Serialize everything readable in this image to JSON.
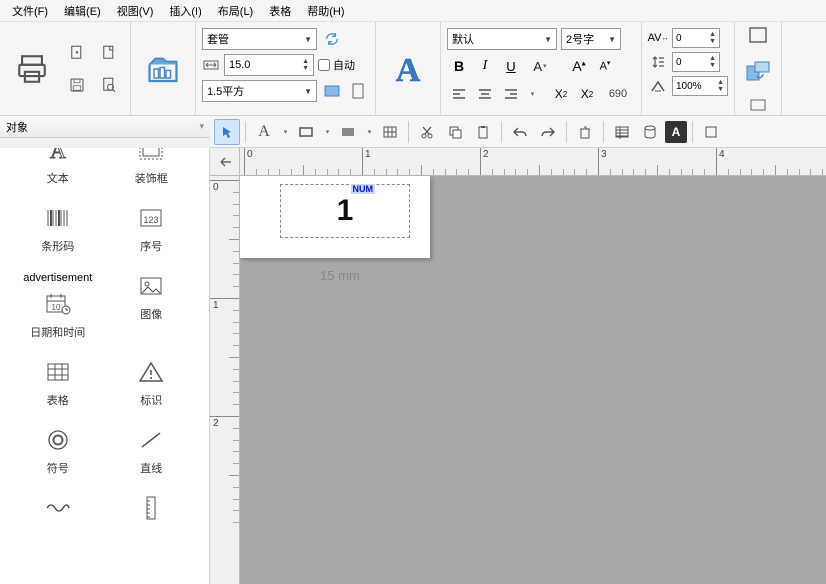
{
  "menu": [
    "文件(F)",
    "编辑(E)",
    "视图(V)",
    "插入(I)",
    "布局(L)",
    "表格",
    "帮助(H)"
  ],
  "toolbar": {
    "tube_combo": "套管",
    "width_value": "15.0",
    "auto_label": "自动",
    "units_combo": "1.5平方",
    "font_combo": "默认",
    "size_combo": "2号字",
    "av_value": "0",
    "line_value": "0",
    "xx_value": "690",
    "zoom_value": "100%"
  },
  "panel": {
    "title": "对象",
    "items": [
      {
        "icon": "text",
        "label": "文本"
      },
      {
        "icon": "frame",
        "label": "装饰框"
      },
      {
        "icon": "barcode",
        "label": "条形码"
      },
      {
        "icon": "serial",
        "label": "序号"
      },
      {
        "icon": "datetime",
        "label": "日期和时间"
      },
      {
        "icon": "image",
        "label": "图像"
      },
      {
        "icon": "table",
        "label": "表格"
      },
      {
        "icon": "warn",
        "label": "标识"
      },
      {
        "icon": "symbol",
        "label": "符号"
      },
      {
        "icon": "line",
        "label": "直线"
      }
    ]
  },
  "ruler": {
    "h_labels": [
      "0",
      "1",
      "2",
      "3",
      "4"
    ],
    "v_labels": [
      "0",
      "1",
      "2"
    ]
  },
  "canvas": {
    "num_tag": "NUM",
    "big_number": "1",
    "dimension": "15 mm"
  }
}
